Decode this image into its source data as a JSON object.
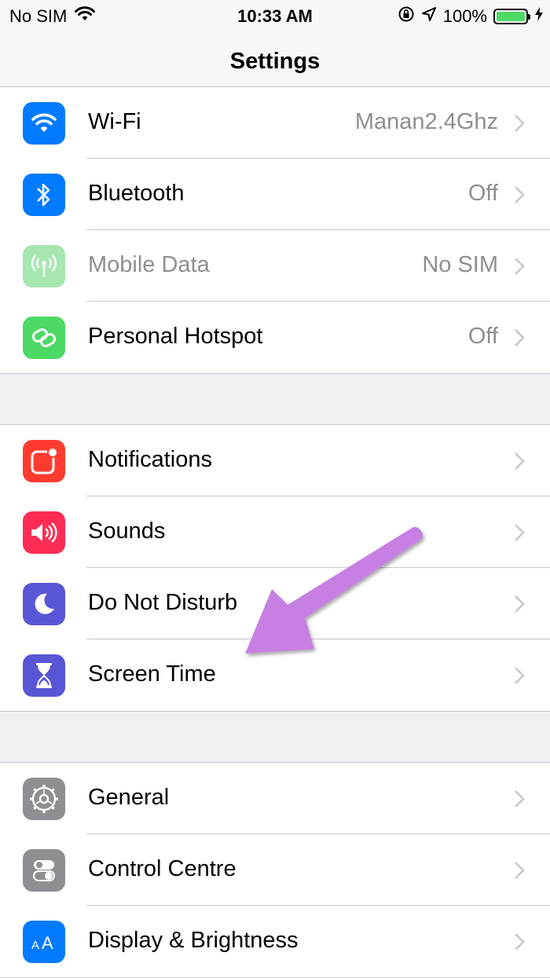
{
  "status_bar": {
    "carrier": "No SIM",
    "time": "10:33 AM",
    "battery_percent": "100%",
    "battery_level": 1.0,
    "icons": [
      "wifi-icon",
      "orientation-lock-icon",
      "location-icon",
      "battery-icon",
      "charging-icon"
    ]
  },
  "nav": {
    "title": "Settings"
  },
  "groups": [
    {
      "rows": [
        {
          "label": "Wi-Fi",
          "value": "Manan2.4Ghz",
          "icon": "wifi-icon",
          "color": "#007aff"
        },
        {
          "label": "Bluetooth",
          "value": "Off",
          "icon": "bluetooth-icon",
          "color": "#007aff"
        },
        {
          "label": "Mobile Data",
          "value": "No SIM",
          "icon": "antenna-icon",
          "color": "#a6e6b0",
          "disabled": true
        },
        {
          "label": "Personal Hotspot",
          "value": "Off",
          "icon": "hotspot-link-icon",
          "color": "#4cd964"
        }
      ]
    },
    {
      "rows": [
        {
          "label": "Notifications",
          "value": "",
          "icon": "notifications-icon",
          "color": "#ff3b30"
        },
        {
          "label": "Sounds",
          "value": "",
          "icon": "speaker-icon",
          "color": "#ff2d55"
        },
        {
          "label": "Do Not Disturb",
          "value": "",
          "icon": "moon-icon",
          "color": "#5856d6"
        },
        {
          "label": "Screen Time",
          "value": "",
          "icon": "hourglass-icon",
          "color": "#5856d6"
        }
      ]
    },
    {
      "rows": [
        {
          "label": "General",
          "value": "",
          "icon": "gear-icon",
          "color": "#8e8e93"
        },
        {
          "label": "Control Centre",
          "value": "",
          "icon": "toggles-icon",
          "color": "#8e8e93"
        },
        {
          "label": "Display & Brightness",
          "value": "",
          "icon": "text-size-icon",
          "color": "#007aff"
        }
      ]
    }
  ],
  "annotation": {
    "arrow_color": "#c77fe3",
    "points_to": "Screen Time"
  }
}
